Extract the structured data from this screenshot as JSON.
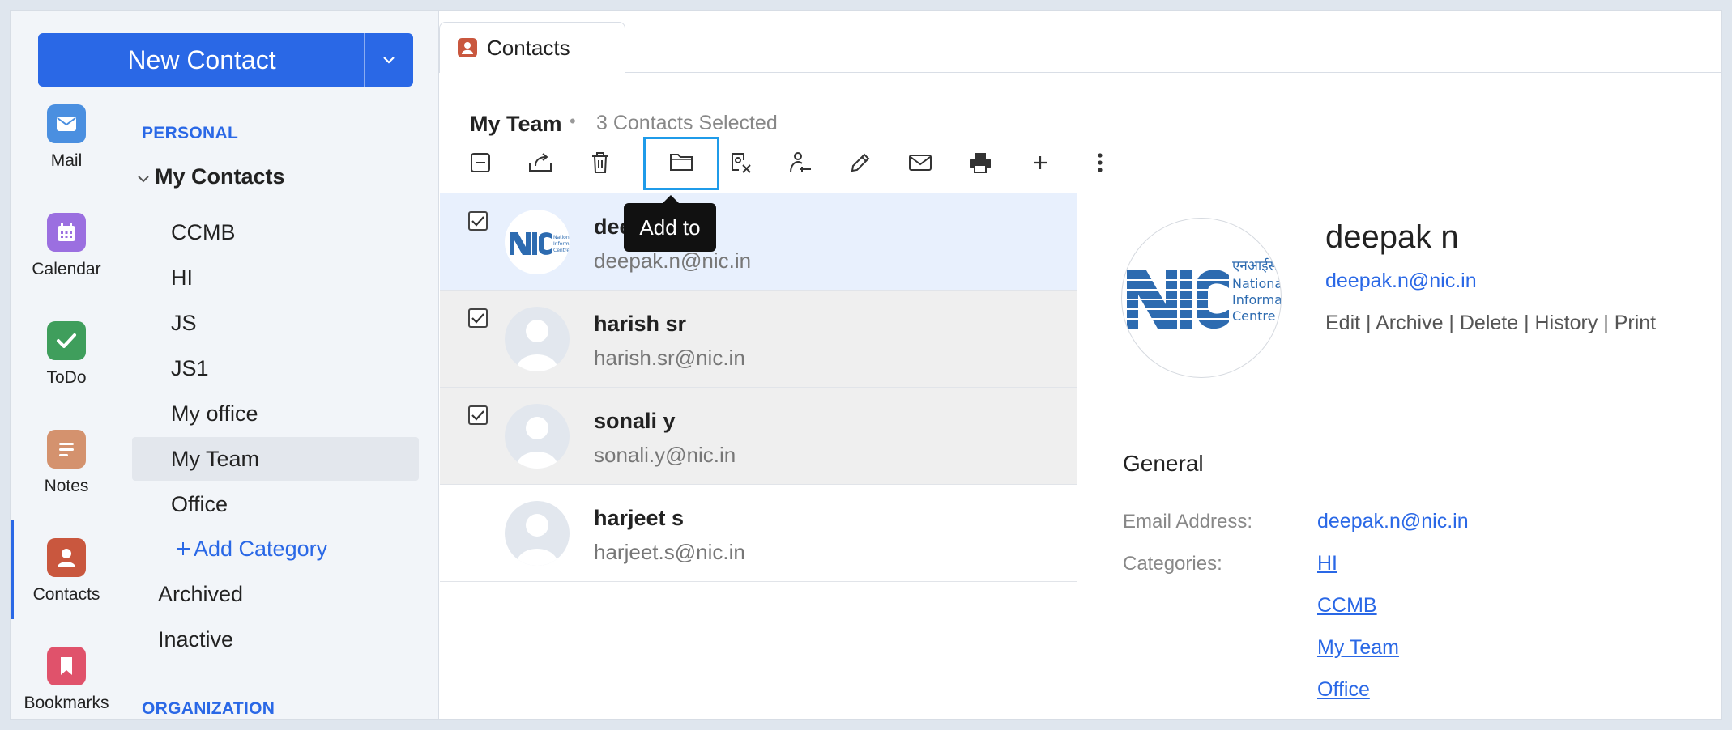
{
  "new_contact": {
    "label": "New Contact"
  },
  "apps": [
    {
      "name": "Mail",
      "icon": "mail-icon",
      "color": "#4a8fe0"
    },
    {
      "name": "Calendar",
      "icon": "calendar-icon",
      "color": "#9b6fe0"
    },
    {
      "name": "ToDo",
      "icon": "checkmark-icon",
      "color": "#3f9e5c"
    },
    {
      "name": "Notes",
      "icon": "notes-icon",
      "color": "#d4926e"
    },
    {
      "name": "Contacts",
      "icon": "contact-person-icon",
      "color": "#c9573e"
    },
    {
      "name": "Bookmarks",
      "icon": "bookmark-icon",
      "color": "#e0526b"
    }
  ],
  "nav": {
    "personal_header": "PERSONAL",
    "my_contacts": "My Contacts",
    "categories": [
      "CCMB",
      "HI",
      "JS",
      "JS1",
      "My office",
      "My Team",
      "Office"
    ],
    "selected_category": "My Team",
    "add_category": "Add Category",
    "archived": "Archived",
    "inactive": "Inactive",
    "organization_header": "ORGANIZATION"
  },
  "tab": {
    "label": "Contacts"
  },
  "header": {
    "title": "My Team",
    "separator": "•",
    "selection": "3 Contacts Selected"
  },
  "toolbar": {
    "icons": [
      "deselect-icon",
      "export-icon",
      "trash-icon",
      "folder-icon",
      "remove-from-category-icon",
      "assign-user-icon",
      "edit-pencil-icon",
      "mail-icon",
      "printer-icon",
      "plus-icon",
      "more-vertical-icon"
    ],
    "tooltip": "Add to"
  },
  "contacts": [
    {
      "name": "deepak n",
      "name_visible": "dee",
      "email": "deepak.n@nic.in",
      "checked": true,
      "selected": true,
      "avatar": "nic-logo"
    },
    {
      "name": "harish sr",
      "email": "harish.sr@nic.in",
      "checked": true,
      "selected": false,
      "avatar": "default"
    },
    {
      "name": "sonali y",
      "email": "sonali.y@nic.in",
      "checked": true,
      "selected": false,
      "avatar": "default"
    },
    {
      "name": "harjeet s",
      "email": "harjeet.s@nic.in",
      "checked": false,
      "selected": false,
      "avatar": "default"
    }
  ],
  "detail": {
    "name": "deepak n",
    "email": "deepak.n@nic.in",
    "actions": [
      "Edit",
      "Archive",
      "Delete",
      "History",
      "Print"
    ],
    "general_title": "General",
    "email_label": "Email Address:",
    "email_value": "deepak.n@nic.in",
    "categories_label": "Categories:",
    "categories": [
      "HI",
      "CCMB",
      "My Team",
      "Office"
    ],
    "logo_text": [
      "एनआईसी",
      "National",
      "Informatics",
      "Centre"
    ]
  },
  "colors": {
    "accent": "#2a68e6",
    "highlight_box": "#1f9be9",
    "selected_row": "#e8f0fd",
    "checked_row": "#efefef"
  }
}
